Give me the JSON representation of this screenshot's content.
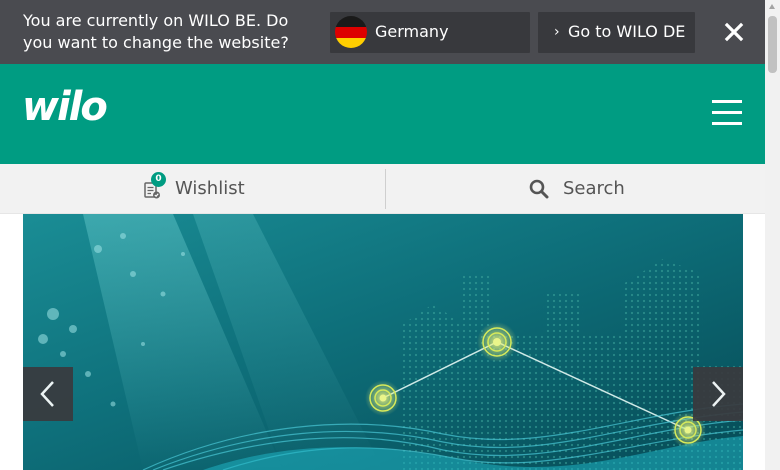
{
  "banner": {
    "message": "You are currently on WILO BE. Do you want to change the website?",
    "country": "Germany",
    "goto_label": "Go to WILO DE",
    "close_icon": "close-icon"
  },
  "header": {
    "logo": "wilo",
    "menu_icon": "hamburger-menu-icon"
  },
  "toolbar": {
    "wishlist_label": "Wishlist",
    "wishlist_count": "0",
    "search_label": "Search"
  },
  "colors": {
    "brand_green": "#009c82",
    "banner_bg": "#4a4b50",
    "toolbar_bg": "#f2f2f2"
  },
  "hero": {
    "prev_icon": "chevron-left-icon",
    "next_icon": "chevron-right-icon"
  }
}
